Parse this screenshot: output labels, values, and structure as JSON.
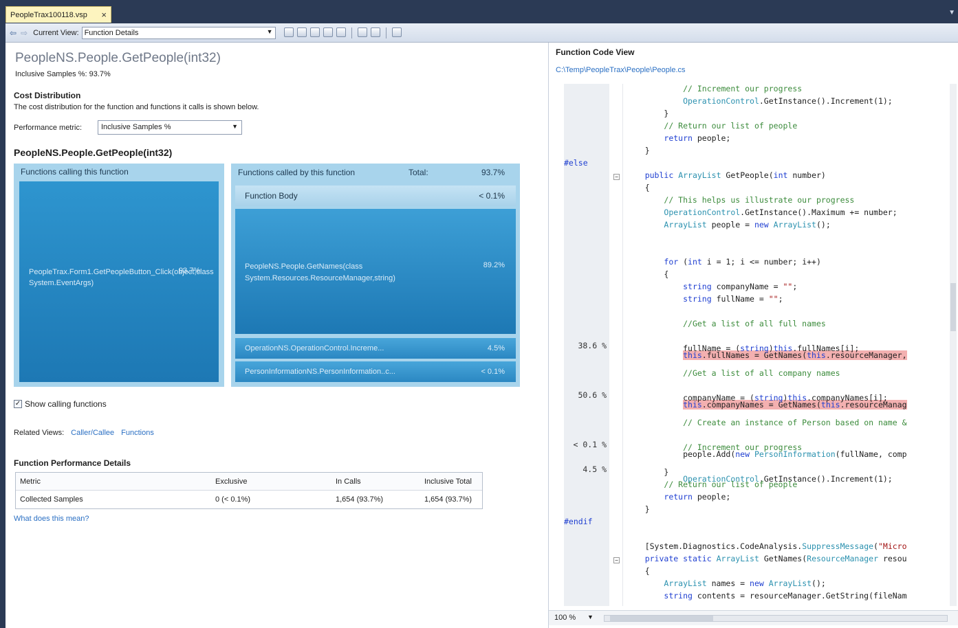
{
  "tab": {
    "title": "PeopleTrax100118.vsp",
    "close": "×"
  },
  "toolbar": {
    "back": "⇦",
    "forward": "⇨",
    "current_view_label": "Current View:",
    "current_view_value": "Function Details"
  },
  "left": {
    "function_title": "PeopleNS.People.GetPeople(int32)",
    "inclusive_samples": "Inclusive Samples %: 93.7%",
    "cost_distribution": {
      "heading": "Cost Distribution",
      "description": "The cost distribution for the function and functions it calls is shown below.",
      "metric_label": "Performance metric:",
      "metric_value": "Inclusive Samples %"
    },
    "distribution_title": "PeopleNS.People.GetPeople(int32)",
    "callers": {
      "header": "Functions calling this function",
      "items": [
        {
          "name": "PeopleTrax.Form1.GetPeopleButton_Click(object,class System.EventArgs)",
          "value": "93.7%"
        }
      ]
    },
    "callees": {
      "header": "Functions called by this function",
      "total_label": "Total:",
      "total_value": "93.7%",
      "function_body": {
        "name": "Function Body",
        "value": "< 0.1%"
      },
      "items": [
        {
          "name": "PeopleNS.People.GetNames(class System.Resources.ResourceManager,string)",
          "value": "89.2%"
        },
        {
          "name": "OperationNS.OperationControl.Increme...",
          "value": "4.5%"
        },
        {
          "name": "PersonInformationNS.PersonInformation..c...",
          "value": "< 0.1%"
        }
      ]
    },
    "show_calling": {
      "label": "Show calling functions",
      "checked": true
    },
    "related_views": {
      "label": "Related Views:",
      "links": [
        "Caller/Callee",
        "Functions"
      ]
    },
    "perf_details": {
      "heading": "Function Performance Details",
      "columns": [
        "Metric",
        "Exclusive",
        "In Calls",
        "Inclusive Total"
      ],
      "rows": [
        [
          "Collected Samples",
          "0 (< 0.1%)",
          "1,654 (93.7%)",
          "1,654 (93.7%)"
        ]
      ]
    },
    "what_link": "What does this mean?"
  },
  "right": {
    "title": "Function Code View",
    "path": "C:\\Temp\\PeopleTrax\\People\\People.cs",
    "zoom": "100 %",
    "gutter": {
      "line_a": "38.6 %",
      "line_b": "50.6 %",
      "line_c": "< 0.1 %",
      "line_d": "4.5 %"
    }
  },
  "colors": {
    "accent": "#2e95cf",
    "highlight": "#f3b0b0",
    "link": "#2a6fc3"
  }
}
